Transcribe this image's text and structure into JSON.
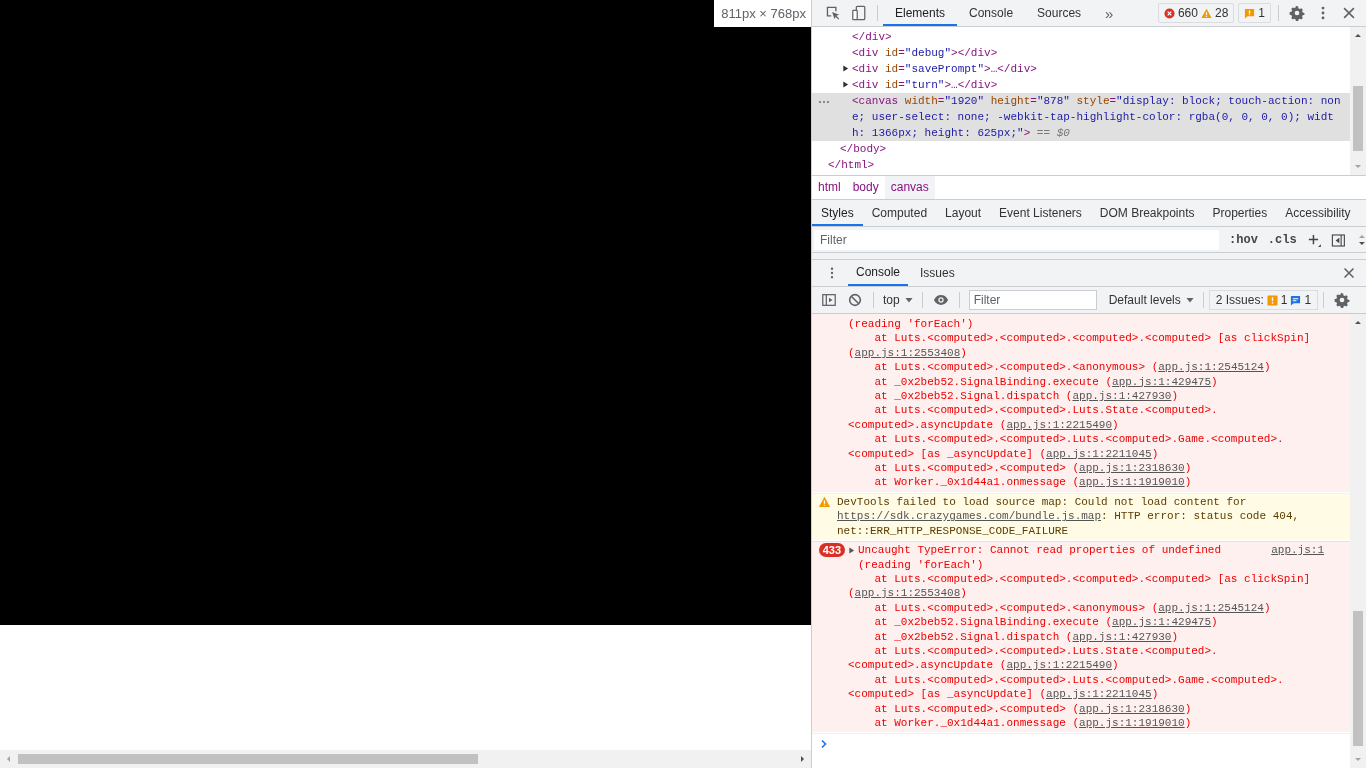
{
  "viewport": {
    "size_label": "811px × 768px"
  },
  "toolbar": {
    "tabs": [
      {
        "label": "Elements",
        "selected": true
      },
      {
        "label": "Console",
        "selected": false
      },
      {
        "label": "Sources",
        "selected": false
      }
    ],
    "more_label": "»",
    "errors": "660",
    "warnings": "28",
    "issues": "1"
  },
  "dom_tree": [
    {
      "selected": false,
      "close": [
        {
          "kind": "tag",
          "text": "</html>"
        }
      ],
      "children": [
        {
          "selected": false,
          "close": [
            {
              "kind": "tag",
              "text": "</body>"
            }
          ],
          "children": [
            {
              "selected": false,
              "close": [
                {
                  "kind": "tag",
                  "text": "</div>"
                }
              ]
            },
            {
              "selected": false,
              "parts": [
                {
                  "kind": "tag",
                  "text": "<div"
                },
                {
                  "kind": "attr",
                  "text": " id"
                },
                {
                  "kind": "tag",
                  "text": "="
                },
                {
                  "kind": "value",
                  "text": "\"debug\""
                },
                {
                  "kind": "tag",
                  "text": "></div>"
                }
              ]
            },
            {
              "selected": false,
              "expanded": false,
              "parts": [
                {
                  "kind": "tag",
                  "text": "<div"
                },
                {
                  "kind": "attr",
                  "text": " id"
                },
                {
                  "kind": "tag",
                  "text": "="
                },
                {
                  "kind": "value",
                  "text": "\"savePrompt\""
                },
                {
                  "kind": "tag",
                  "text": ">…</div>"
                }
              ]
            },
            {
              "selected": false,
              "expanded": false,
              "parts": [
                {
                  "kind": "tag",
                  "text": "<div"
                },
                {
                  "kind": "attr",
                  "text": " id"
                },
                {
                  "kind": "tag",
                  "text": "="
                },
                {
                  "kind": "value",
                  "text": "\"turn\""
                },
                {
                  "kind": "tag",
                  "text": ">…</div>"
                }
              ]
            },
            {
              "selected": true,
              "parts": [
                {
                  "kind": "tag",
                  "text": "<canvas"
                },
                {
                  "kind": "attr",
                  "text": " width"
                },
                {
                  "kind": "tag",
                  "text": "="
                },
                {
                  "kind": "value",
                  "text": "\"1920\""
                },
                {
                  "kind": "attr",
                  "text": " height"
                },
                {
                  "kind": "tag",
                  "text": "="
                },
                {
                  "kind": "value",
                  "text": "\"878\""
                },
                {
                  "kind": "attr",
                  "text": " style"
                },
                {
                  "kind": "tag",
                  "text": "="
                },
                {
                  "kind": "value",
                  "text": "\"display: block; touch-action: none; user-select: none; -webkit-tap-highlight-color: rgba(0, 0, 0, 0); width: 1366px; height: 625px;\""
                },
                {
                  "kind": "tag",
                  "text": ">"
                },
                {
                  "kind": "hint",
                  "text": " == $0"
                }
              ]
            }
          ]
        }
      ]
    }
  ],
  "breadcrumbs": [
    {
      "label": "html",
      "selected": false
    },
    {
      "label": "body",
      "selected": false
    },
    {
      "label": "canvas",
      "selected": true
    }
  ],
  "style_tabs": [
    {
      "label": "Styles",
      "selected": true
    },
    {
      "label": "Computed",
      "selected": false
    },
    {
      "label": "Layout",
      "selected": false
    },
    {
      "label": "Event Listeners",
      "selected": false
    },
    {
      "label": "DOM Breakpoints",
      "selected": false
    },
    {
      "label": "Properties",
      "selected": false
    },
    {
      "label": "Accessibility",
      "selected": false
    }
  ],
  "styles_filter": {
    "placeholder": "Filter",
    "hov": ":hov",
    "cls": ".cls"
  },
  "drawer_tabs": [
    {
      "label": "Console",
      "selected": true
    },
    {
      "label": "Issues",
      "selected": false
    }
  ],
  "console_toolbar": {
    "context": "top",
    "filter_placeholder": "Filter",
    "levels": "Default levels",
    "issues_label": "2 Issues:",
    "issue_warnings": "1",
    "issue_infos": "1"
  },
  "messages": [
    {
      "kind": "error",
      "lines": [
        {
          "text": "(reading 'forEach')"
        },
        {
          "text": "    at Luts.<computed>.<computed>.<computed>.<computed> [as clickSpin] (",
          "link": "app.js:1:2553408",
          "after": ")"
        },
        {
          "text": "    at Luts.<computed>.<computed>.<anonymous> (",
          "link": "app.js:1:2545124",
          "after": ")"
        },
        {
          "text": "    at _0x2beb52.SignalBinding.execute (",
          "link": "app.js:1:429475",
          "after": ")"
        },
        {
          "text": "    at _0x2beb52.Signal.dispatch (",
          "link": "app.js:1:427930",
          "after": ")"
        },
        {
          "text": "    at Luts.<computed>.<computed>.Luts.State.<computed>.<computed>.asyncUpdate (",
          "link": "app.js:1:2215490",
          "after": ")"
        },
        {
          "text": "    at Luts.<computed>.<computed>.Luts.<computed>.Game.<computed>.<computed> [as _asyncUpdate] (",
          "link": "app.js:1:2211045",
          "after": ")"
        },
        {
          "text": "    at Luts.<computed>.<computed> (",
          "link": "app.js:1:2318630",
          "after": ")"
        },
        {
          "text": "    at Worker._0x1d44a1.onmessage (",
          "link": "app.js:1:1919010",
          "after": ")"
        }
      ]
    },
    {
      "kind": "warning",
      "lines": [
        {
          "text": "DevTools failed to load source map: Could not load content for ",
          "link": "https://sdk.crazygames.com/bundle.js.map",
          "after": ": HTTP error: status code 404, net::ERR_HTTP_RESPONSE_CODE_FAILURE"
        }
      ]
    },
    {
      "kind": "error",
      "count": "433",
      "expanded": false,
      "summary": "Uncaught TypeError: Cannot read properties of undefined (reading 'forEach')",
      "source": "app.js:1",
      "lines": [
        {
          "text": "    at Luts.<computed>.<computed>.<computed>.<computed> [as clickSpin] (",
          "link": "app.js:1:2553408",
          "after": ")"
        },
        {
          "text": "    at Luts.<computed>.<computed>.<anonymous> (",
          "link": "app.js:1:2545124",
          "after": ")"
        },
        {
          "text": "    at _0x2beb52.SignalBinding.execute (",
          "link": "app.js:1:429475",
          "after": ")"
        },
        {
          "text": "    at _0x2beb52.Signal.dispatch (",
          "link": "app.js:1:427930",
          "after": ")"
        },
        {
          "text": "    at Luts.<computed>.<computed>.Luts.State.<computed>.<computed>.asyncUpdate (",
          "link": "app.js:1:2215490",
          "after": ")"
        },
        {
          "text": "    at Luts.<computed>.<computed>.Luts.<computed>.Game.<computed>.<computed> [as _asyncUpdate] (",
          "link": "app.js:1:2211045",
          "after": ")"
        },
        {
          "text": "    at Luts.<computed>.<computed> (",
          "link": "app.js:1:2318630",
          "after": ")"
        },
        {
          "text": "    at Worker._0x1d44a1.onmessage (",
          "link": "app.js:1:1919010",
          "after": ")"
        }
      ]
    }
  ]
}
